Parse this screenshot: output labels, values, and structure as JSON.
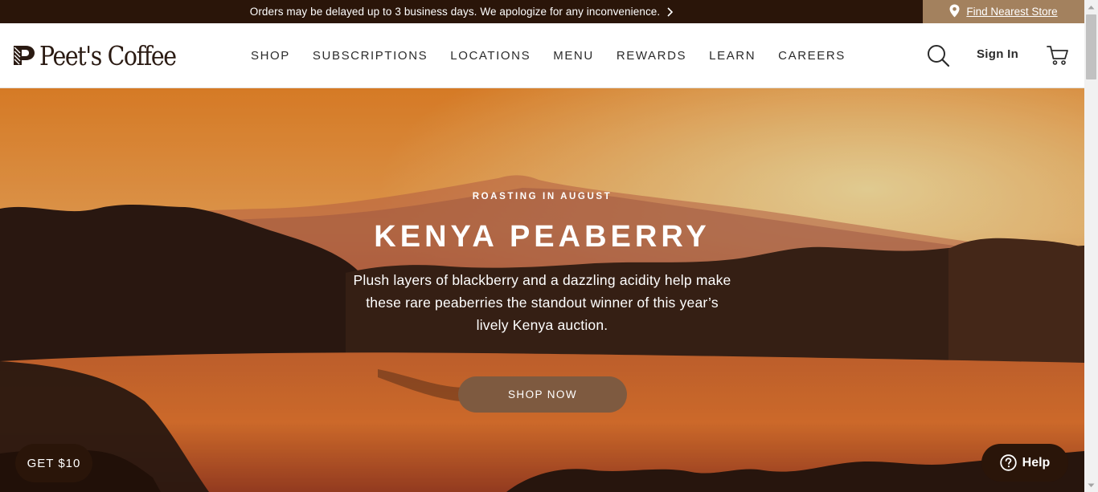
{
  "announcement": {
    "text": "Orders may be delayed up to 3 business days. We apologize for any inconvenience.",
    "chevron_icon": "chevron-right-icon",
    "store_link": "Find Nearest Store",
    "store_icon": "map-pin-icon"
  },
  "header": {
    "logo_text": "Peet's Coffee",
    "nav": [
      {
        "label": "SHOP"
      },
      {
        "label": "SUBSCRIPTIONS"
      },
      {
        "label": "LOCATIONS"
      },
      {
        "label": "MENU"
      },
      {
        "label": "REWARDS"
      },
      {
        "label": "LEARN"
      },
      {
        "label": "CAREERS"
      }
    ],
    "search_icon": "search-icon",
    "sign_in": "Sign In",
    "cart_icon": "cart-icon"
  },
  "hero": {
    "eyebrow": "ROASTING IN AUGUST",
    "headline": "KENYA PEABERRY",
    "description": "Plush layers of blackberry and a dazzling acidity help make these rare peaberries the standout winner of this year’s lively Kenya auction.",
    "cta": "SHOP NOW"
  },
  "floating": {
    "promo": "GET $10",
    "help": "Help",
    "help_icon": "question-circle-icon"
  },
  "colors": {
    "dark_brown": "#2a1509",
    "store_tan": "#a3815e",
    "cta_brown": "#7e5a40"
  }
}
